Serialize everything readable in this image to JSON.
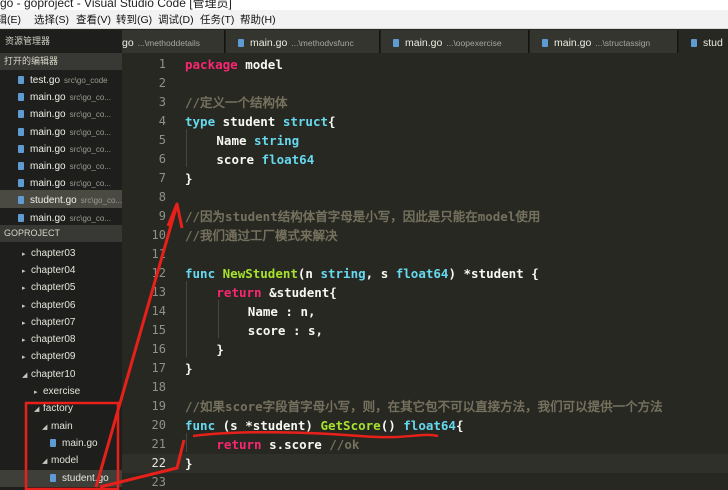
{
  "window": {
    "title": "go - goproject - Visual Studio Code [管理员]"
  },
  "menu": [
    "编辑(E)",
    "选择(S)",
    "查看(V)",
    "转到(G)",
    "调试(D)",
    "任务(T)",
    "帮助(H)"
  ],
  "sidebar": {
    "title": "资源管理器",
    "open_editors_label": "打开的编辑器",
    "open_editors": [
      {
        "name": "test.go",
        "path": "src\\go_code"
      },
      {
        "name": "main.go",
        "path": "src\\go_co..."
      },
      {
        "name": "main.go",
        "path": "src\\go_co..."
      },
      {
        "name": "main.go",
        "path": "src\\go_co..."
      },
      {
        "name": "main.go",
        "path": "src\\go_co..."
      },
      {
        "name": "main.go",
        "path": "src\\go_co..."
      },
      {
        "name": "main.go",
        "path": "src\\go_co..."
      },
      {
        "name": "student.go",
        "path": "src\\go_co..."
      },
      {
        "name": "main.go",
        "path": "src\\go_co..."
      }
    ],
    "project_label": "GOPROJECT",
    "tree": [
      {
        "label": "chapter03",
        "twisty": "▸"
      },
      {
        "label": "chapter04",
        "twisty": "▸"
      },
      {
        "label": "chapter05",
        "twisty": "▸"
      },
      {
        "label": "chapter06",
        "twisty": "▸"
      },
      {
        "label": "chapter07",
        "twisty": "▸"
      },
      {
        "label": "chapter08",
        "twisty": "▸"
      },
      {
        "label": "chapter09",
        "twisty": "▸"
      },
      {
        "label": "chapter10",
        "twisty": "◢"
      },
      {
        "label": "exercise",
        "twisty": "▸"
      },
      {
        "label": "factory",
        "twisty": "◢"
      },
      {
        "label": "main",
        "twisty": "◢"
      },
      {
        "label": "main.go",
        "twisty": ""
      },
      {
        "label": "model",
        "twisty": "◢"
      },
      {
        "label": "student.go",
        "twisty": ""
      }
    ]
  },
  "tabs": [
    {
      "name": "go",
      "path": "...\\methoddetails"
    },
    {
      "name": "main.go",
      "path": "...\\methodvsfunc"
    },
    {
      "name": "main.go",
      "path": "...\\oopexercise"
    },
    {
      "name": "main.go",
      "path": "...\\structassign"
    },
    {
      "name": "stud",
      "path": ""
    }
  ],
  "editor": {
    "current_line": "22",
    "lines": [
      {
        "n": "1",
        "code": "package model"
      },
      {
        "n": "2",
        "code": ""
      },
      {
        "n": "3",
        "code": "//定义一个结构体"
      },
      {
        "n": "4",
        "code": "type student struct{"
      },
      {
        "n": "5",
        "code": "Name string"
      },
      {
        "n": "6",
        "code": "score float64"
      },
      {
        "n": "7",
        "code": "}"
      },
      {
        "n": "8",
        "code": ""
      },
      {
        "n": "9",
        "code": "//因为student结构体首字母是小写，因此是只能在model使用"
      },
      {
        "n": "10",
        "code": "//我们通过工厂模式来解决"
      },
      {
        "n": "11",
        "code": ""
      },
      {
        "n": "12",
        "code": "func NewStudent(n string, s float64) *student {"
      },
      {
        "n": "13",
        "code": "return &student{"
      },
      {
        "n": "14",
        "code": "Name : n,"
      },
      {
        "n": "15",
        "code": "score : s,"
      },
      {
        "n": "16",
        "code": "}"
      },
      {
        "n": "17",
        "code": "}"
      },
      {
        "n": "18",
        "code": ""
      },
      {
        "n": "19",
        "code": "//如果score字段首字母小写，则，在其它包不可以直接方法，我们可以提供一个方法"
      },
      {
        "n": "20",
        "code": "func (s *student) GetScore() float64{"
      },
      {
        "n": "21",
        "code": "return s.score //ok"
      },
      {
        "n": "22",
        "code": "}"
      },
      {
        "n": "23",
        "code": ""
      }
    ]
  },
  "colors": {
    "background": "#272822",
    "sidebar": "#1e1f1c",
    "keyword": "#66d9ef",
    "type": "#a6e22e",
    "comment": "#75715e",
    "annotation": "#e8201a"
  }
}
